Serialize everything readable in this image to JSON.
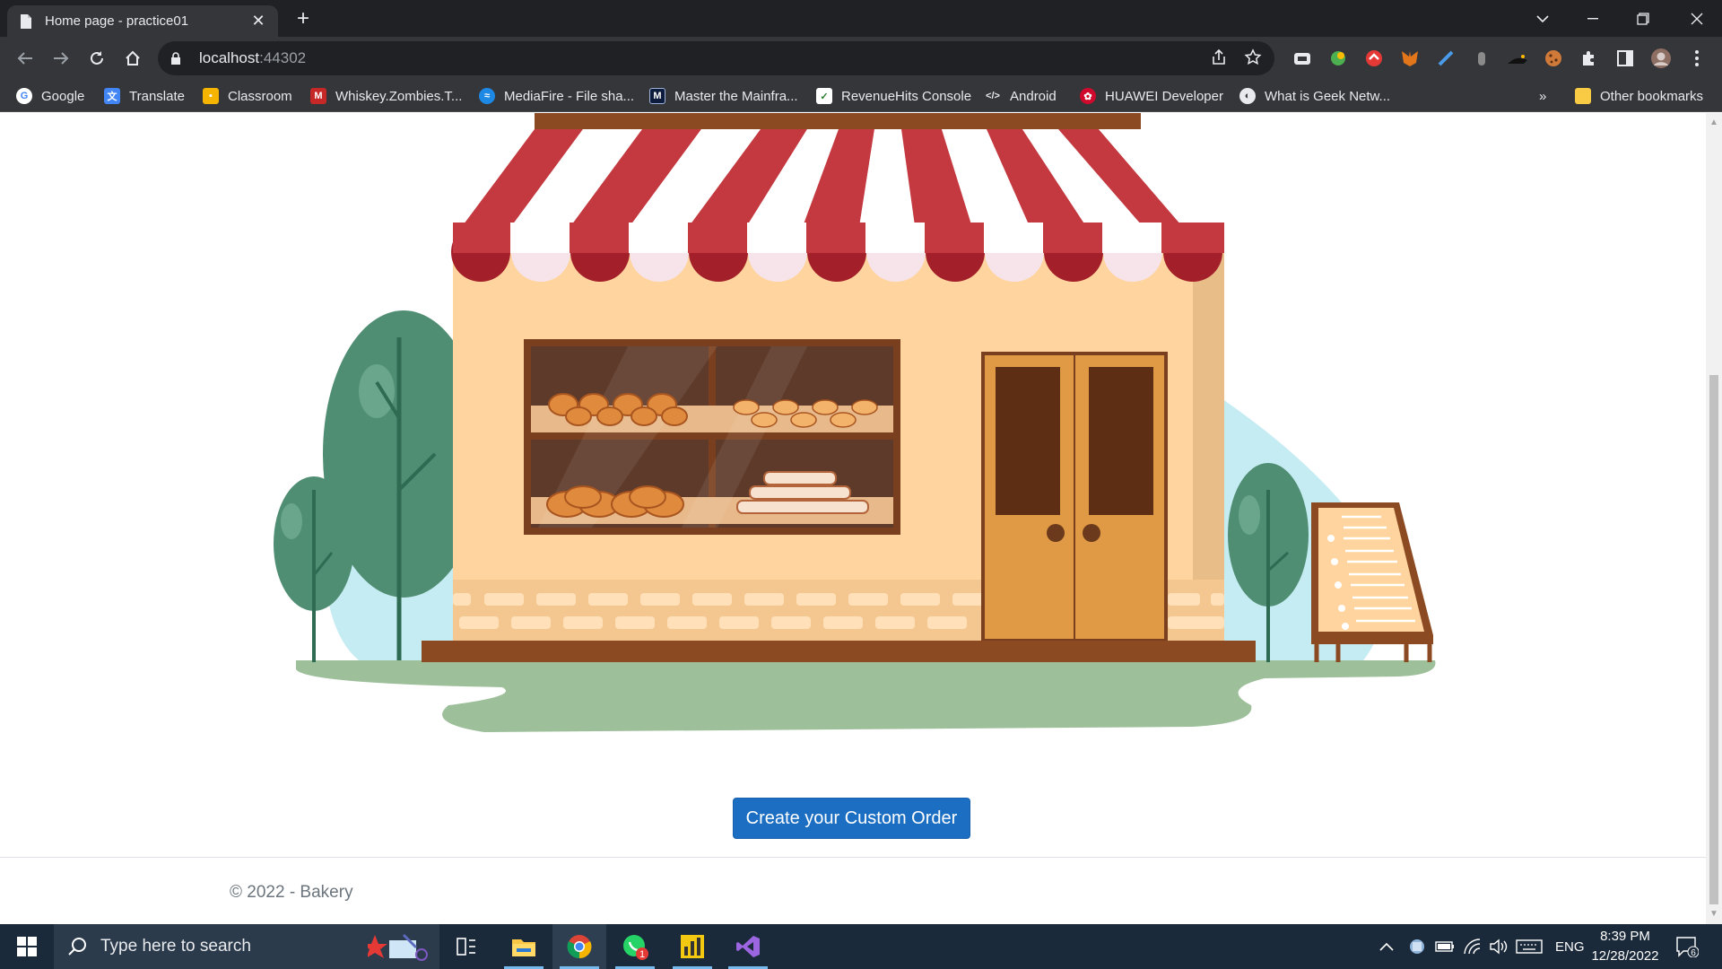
{
  "browser": {
    "tab_title": "Home page - practice01",
    "url_host": "localhost",
    "url_port": ":44302"
  },
  "bookmarks": [
    {
      "label": "Google"
    },
    {
      "label": "Translate"
    },
    {
      "label": "Classroom"
    },
    {
      "label": "Whiskey.Zombies.T..."
    },
    {
      "label": "MediaFire - File sha..."
    },
    {
      "label": "Master the Mainfra..."
    },
    {
      "label": "RevenueHits Console"
    },
    {
      "label": "Android"
    },
    {
      "label": "HUAWEI Developer"
    },
    {
      "label": "What is Geek Netw..."
    }
  ],
  "bookmarks_overflow": "»",
  "other_bookmarks": "Other bookmarks",
  "main": {
    "cta_label": "Create your Custom Order"
  },
  "footer": {
    "text": "© 2022 - Bakery"
  },
  "taskbar": {
    "search_placeholder": "Type here to search",
    "whatsapp_badge": "1",
    "lang": "ENG",
    "time": "8:39 PM",
    "date": "12/28/2022",
    "notifications": "6"
  },
  "colors": {
    "awning_red": "#c4393f",
    "wall": "#ffd49e",
    "tree": "#4f8e73",
    "ground": "#9dbf9a",
    "button": "#1b6ec2"
  }
}
